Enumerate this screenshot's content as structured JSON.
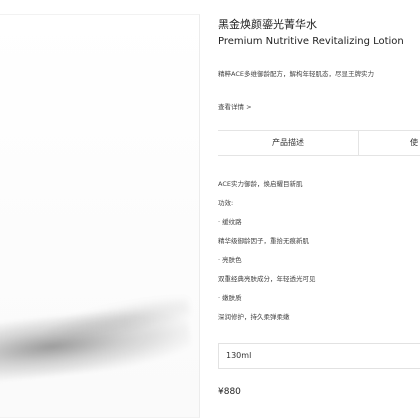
{
  "product": {
    "title_cn": "黑金焕颜鎏光菁华水",
    "title_en": "Premium Nutritive Revitalizing Lotion",
    "tagline": "精粹ACE多维御龄配方，解构年轻肌态，尽显王牌实力",
    "details_link": "查看详情 >"
  },
  "tabs": [
    {
      "label": "产品描述"
    },
    {
      "label": "使"
    }
  ],
  "description": [
    "ACE实力御龄，焕启耀目新肌",
    "功效:",
    "· 缓纹路",
    "精华级御龄因子，重拾无痕新肌",
    "· 亮肤色",
    "双重经典亮肤成分，年轻透光可见",
    "· 嫩肤质",
    "深润修护，持久柔弹柔嫩"
  ],
  "size": {
    "selected": "130ml"
  },
  "price": "¥880"
}
